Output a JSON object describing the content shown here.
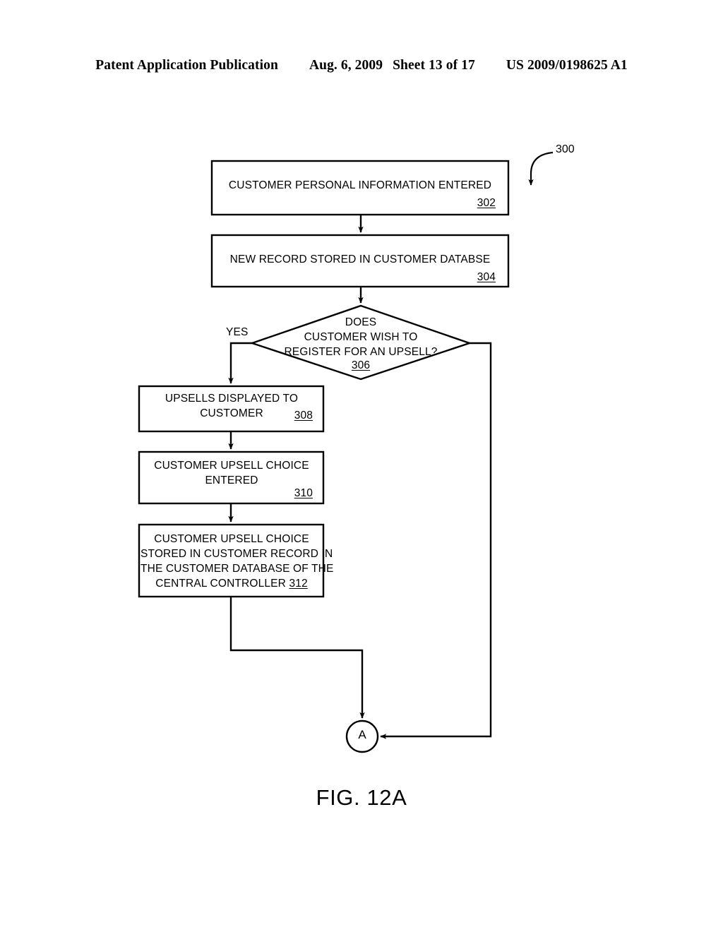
{
  "header": {
    "publication": "Patent Application Publication",
    "date": "Aug. 6, 2009",
    "sheet": "Sheet 13 of 17",
    "patent_number": "US 2009/0198625 A1"
  },
  "figure": {
    "caption": "FIG. 12A",
    "diagram_reference": "300",
    "connector_label": "A",
    "branch_label_yes": "YES"
  },
  "nodes": {
    "n302": {
      "text": "CUSTOMER PERSONAL INFORMATION ENTERED",
      "ref": "302"
    },
    "n304": {
      "text": "NEW RECORD STORED IN CUSTOMER DATABSE",
      "ref": "304"
    },
    "n306": {
      "line1": "DOES",
      "line2": "CUSTOMER WISH TO",
      "line3": "REGISTER FOR AN UPSELL?",
      "ref": "306"
    },
    "n308": {
      "line1": "UPSELLS DISPLAYED TO",
      "line2": "CUSTOMER",
      "ref": "308"
    },
    "n310": {
      "line1": "CUSTOMER UPSELL CHOICE",
      "line2": "ENTERED",
      "ref": "310"
    },
    "n312": {
      "line1": "CUSTOMER UPSELL CHOICE",
      "line2": "STORED IN CUSTOMER RECORD IN",
      "line3": "THE CUSTOMER DATABASE OF THE",
      "line4": "CENTRAL CONTROLLER",
      "ref": "312"
    }
  },
  "colors": {
    "ink": "#000000",
    "paper": "#ffffff"
  }
}
